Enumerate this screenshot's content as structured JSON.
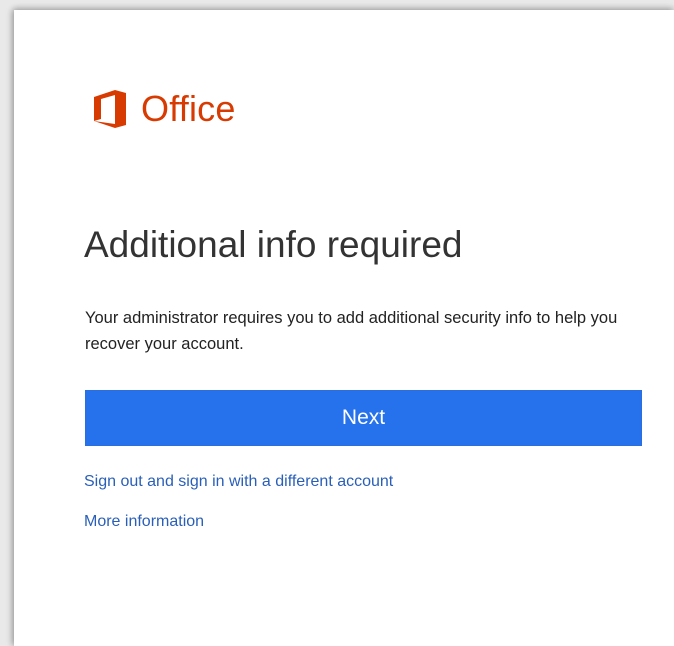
{
  "brand": {
    "icon": "office-logo-icon",
    "name": "Office",
    "color": "#d83b01"
  },
  "page": {
    "title": "Additional info required",
    "description": "Your administrator requires you to add additional security info to help you recover your account."
  },
  "actions": {
    "next_label": "Next",
    "next_color": "#2672ec"
  },
  "links": {
    "switch_account": "Sign out and sign in with a different account",
    "more_info": "More information",
    "color": "#2a5fb8"
  }
}
